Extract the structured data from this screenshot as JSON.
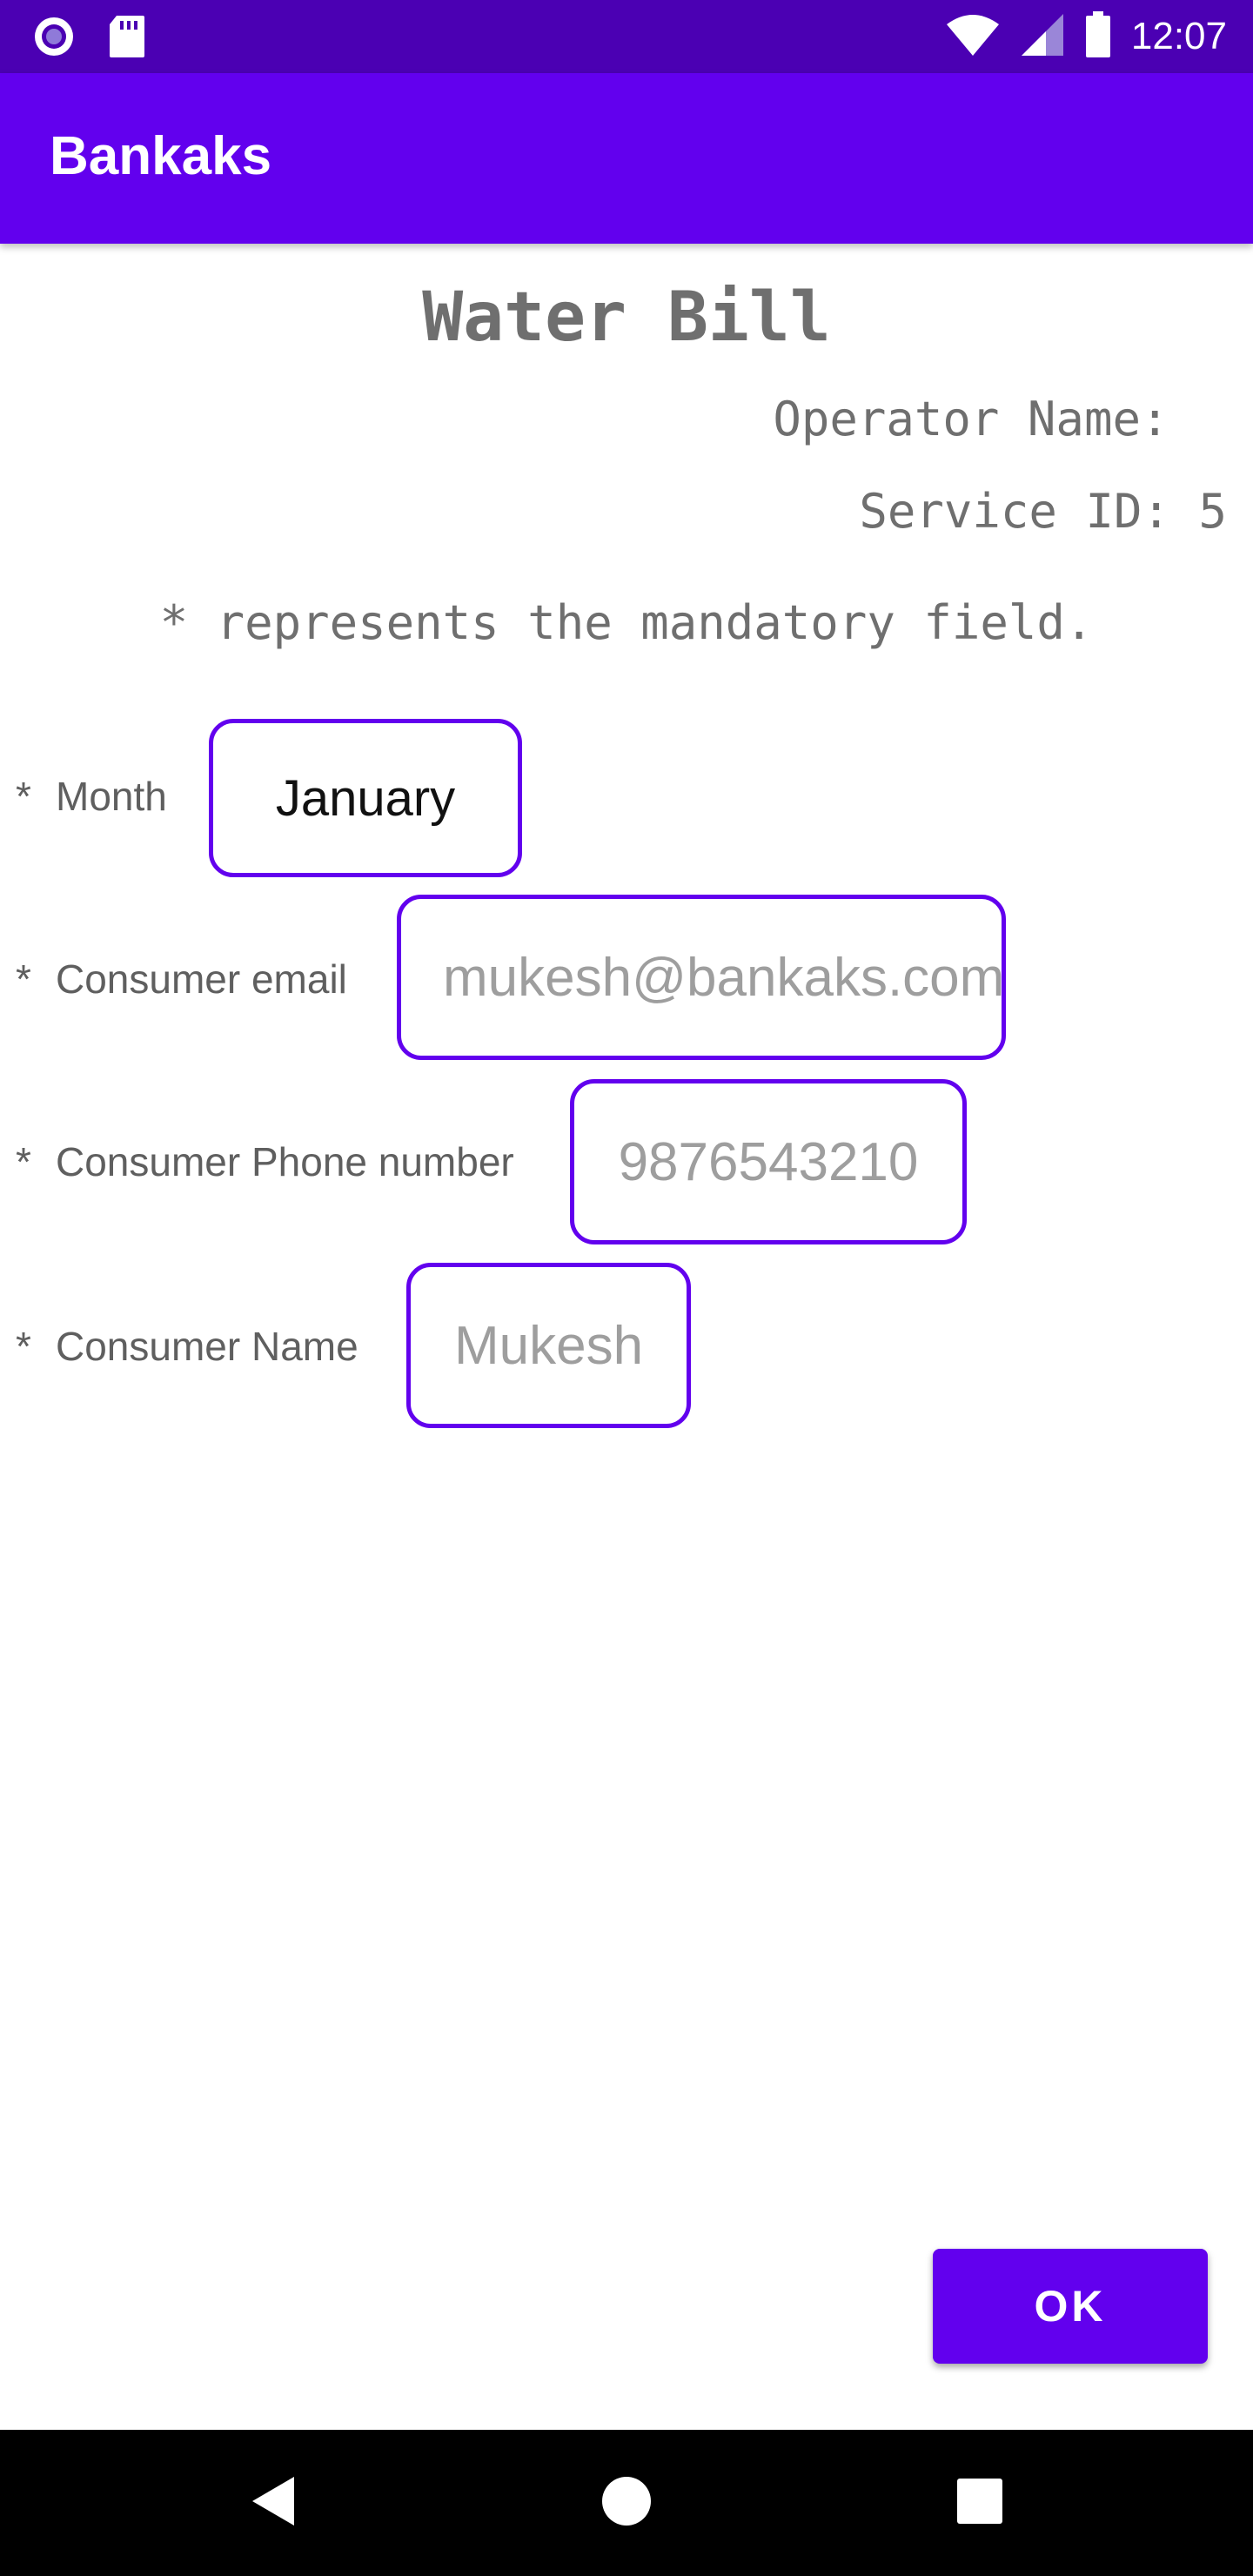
{
  "status_bar": {
    "time": "12:07",
    "icons": [
      "notification-dot-icon",
      "sd-card-icon",
      "wifi-icon",
      "signal-icon",
      "battery-icon"
    ]
  },
  "app_bar": {
    "title": "Bankaks"
  },
  "bill": {
    "title": "Water Bill",
    "operator_label": "Operator Name: ",
    "service_id": "Service ID: 5",
    "mandatory_note": "* represents the mandatory field."
  },
  "fields": [
    {
      "asterisk": "*",
      "label": "Month",
      "value": "January"
    },
    {
      "asterisk": "*",
      "label": "Consumer email",
      "placeholder": "mukesh@bankaks.com"
    },
    {
      "asterisk": "*",
      "label": "Consumer Phone number",
      "placeholder": "9876543210"
    },
    {
      "asterisk": "*",
      "label": "Consumer Name",
      "placeholder": "Mukesh"
    }
  ],
  "ok_button": {
    "label": "OK"
  },
  "colors": {
    "status_bar": "#4b00b3",
    "app_bar": "#6200ee",
    "accent": "#6200ee",
    "nav_bar": "#000000"
  },
  "nav_bar": {
    "icons": [
      "back-icon",
      "home-icon",
      "recents-icon"
    ]
  }
}
